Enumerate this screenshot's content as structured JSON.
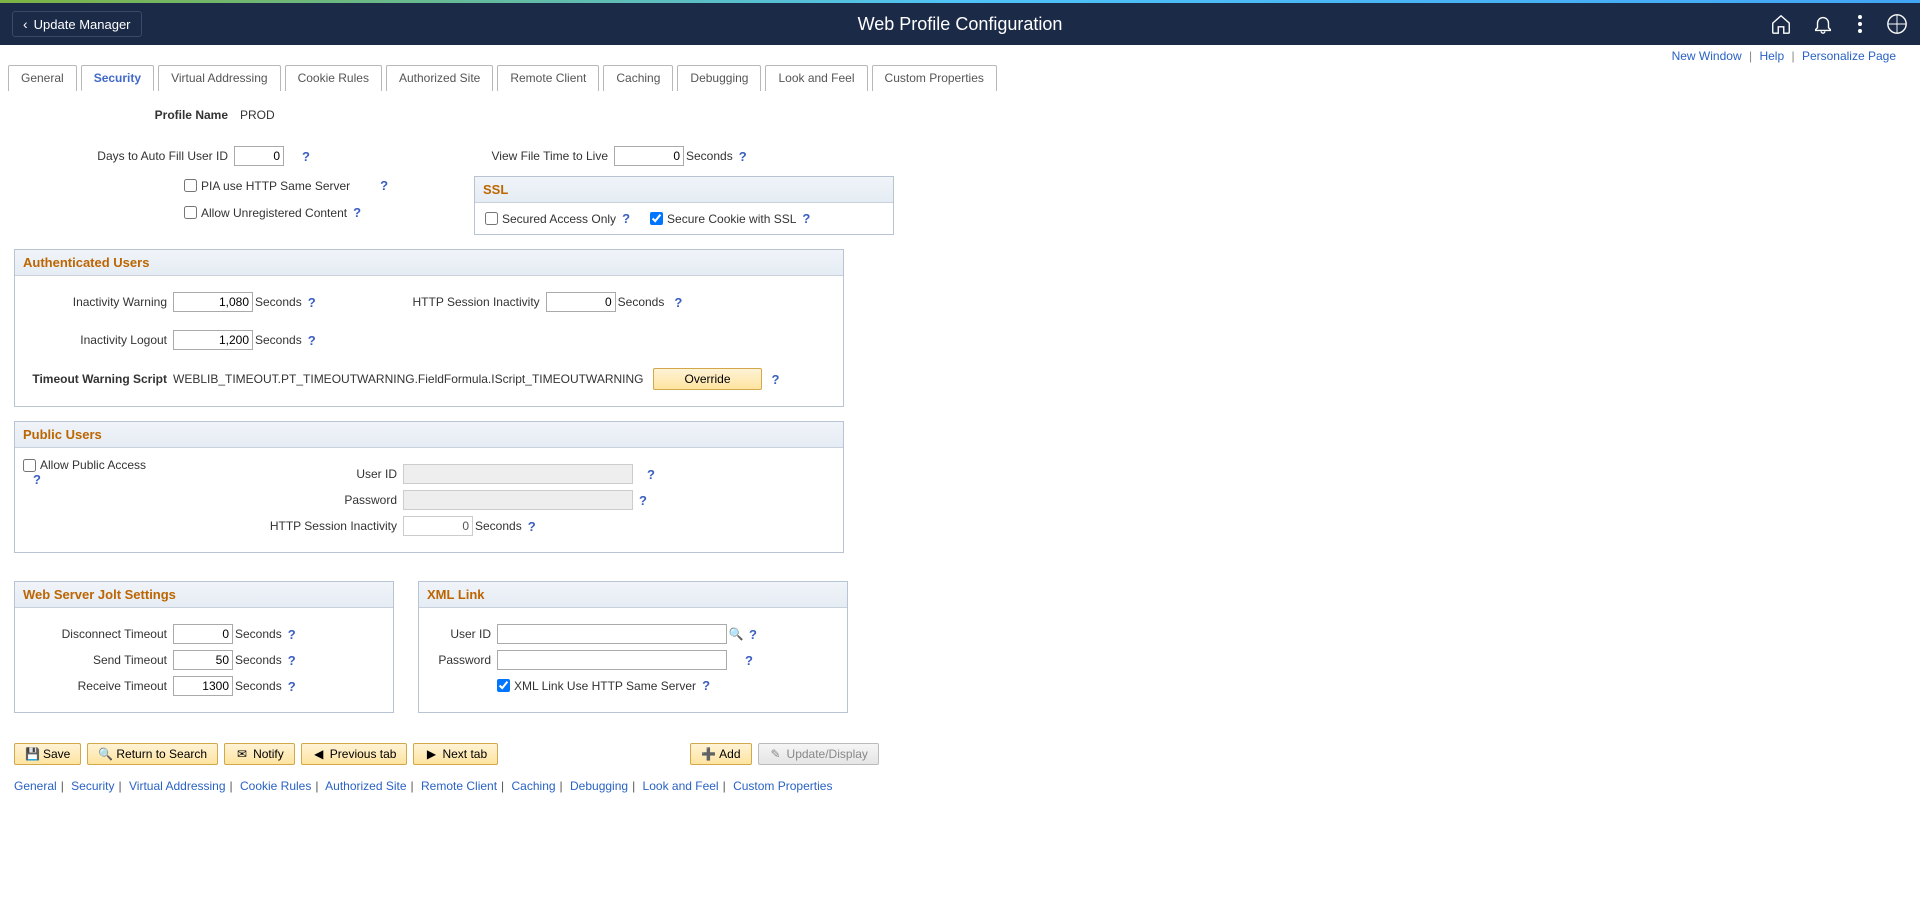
{
  "header": {
    "back_label": "Update Manager",
    "title": "Web Profile Configuration"
  },
  "page_links": {
    "new_window": "New Window",
    "help": "Help",
    "personalize": "Personalize Page"
  },
  "tabs": [
    "General",
    "Security",
    "Virtual Addressing",
    "Cookie Rules",
    "Authorized Site",
    "Remote Client",
    "Caching",
    "Debugging",
    "Look and Feel",
    "Custom Properties"
  ],
  "active_tab": "Security",
  "profile": {
    "label": "Profile Name",
    "value": "PROD"
  },
  "fields": {
    "days_autofill_label": "Days to Auto Fill User ID",
    "days_autofill_value": "0",
    "pia_same_server": "PIA use HTTP Same Server",
    "allow_unregistered": "Allow Unregistered Content",
    "view_file_ttl_label": "View File Time to Live",
    "view_file_ttl_value": "0",
    "seconds": "Seconds"
  },
  "ssl": {
    "title": "SSL",
    "secured_access": "Secured Access Only",
    "secure_cookie": "Secure Cookie with SSL"
  },
  "auth_users": {
    "title": "Authenticated Users",
    "inactivity_warning_label": "Inactivity Warning",
    "inactivity_warning_value": "1,080",
    "inactivity_logout_label": "Inactivity Logout",
    "inactivity_logout_value": "1,200",
    "http_session_label": "HTTP Session Inactivity",
    "http_session_value": "0",
    "timeout_script_label": "Timeout Warning Script",
    "timeout_script_value": "WEBLIB_TIMEOUT.PT_TIMEOUTWARNING.FieldFormula.IScript_TIMEOUTWARNING",
    "override": "Override"
  },
  "public_users": {
    "title": "Public Users",
    "allow_public": "Allow Public Access",
    "user_id_label": "User ID",
    "password_label": "Password",
    "http_session_label": "HTTP Session Inactivity",
    "http_session_value": "0"
  },
  "jolt": {
    "title": "Web Server Jolt Settings",
    "disconnect_label": "Disconnect Timeout",
    "disconnect_value": "0",
    "send_label": "Send Timeout",
    "send_value": "50",
    "receive_label": "Receive Timeout",
    "receive_value": "1300"
  },
  "xml_link": {
    "title": "XML Link",
    "user_id_label": "User ID",
    "password_label": "Password",
    "same_server": "XML Link Use HTTP Same Server"
  },
  "buttons": {
    "save": "Save",
    "return": "Return to Search",
    "notify": "Notify",
    "prev_tab": "Previous tab",
    "next_tab": "Next tab",
    "add": "Add",
    "update": "Update/Display"
  }
}
